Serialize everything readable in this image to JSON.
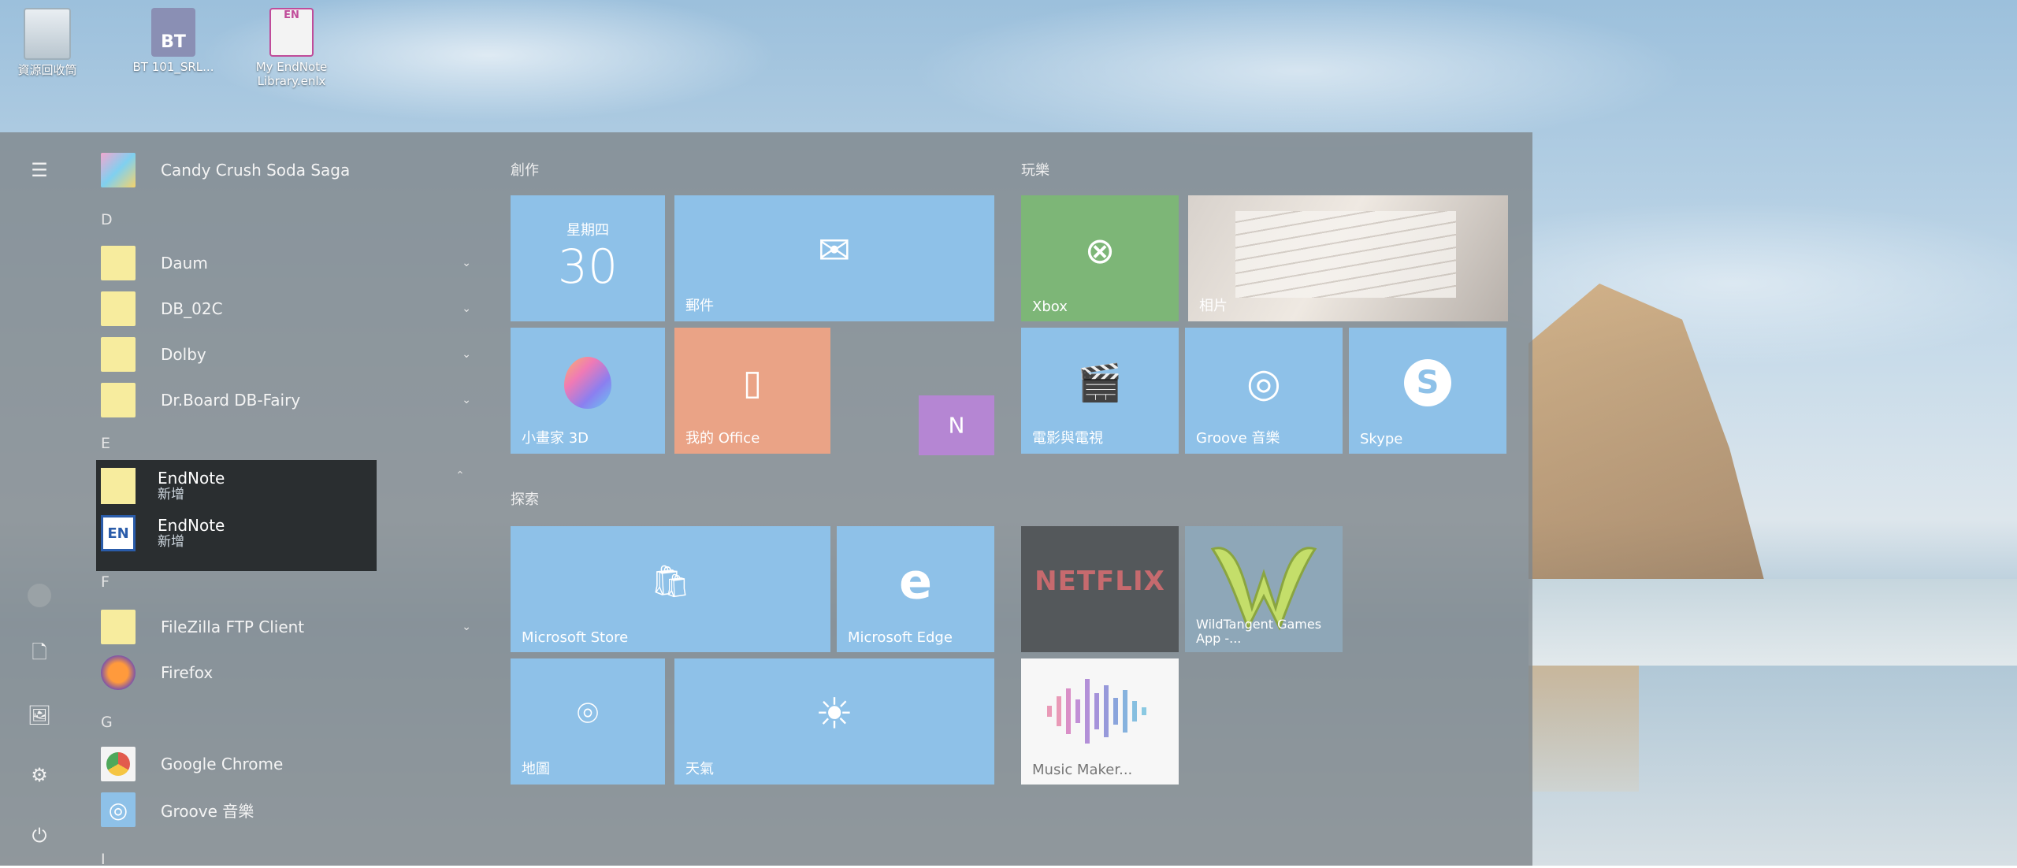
{
  "desktop": {
    "icons": [
      {
        "label": "資源回收筒",
        "icon": "recycle-bin-icon"
      },
      {
        "label": "BT 101_SRL...",
        "icon": "bt-app-icon",
        "badge": "BT"
      },
      {
        "label": "My EndNote Library.enlx",
        "icon": "endnote-library-file-icon",
        "badge": "EN"
      }
    ]
  },
  "rail": {
    "icons": [
      "hamburger-menu-icon",
      "user-avatar-icon",
      "documents-icon",
      "pictures-icon",
      "settings-gear-icon",
      "power-icon"
    ]
  },
  "app_list": {
    "candy": "Candy Crush Soda Saga",
    "letter_d": "D",
    "daum": "Daum",
    "db02c": "DB_02C",
    "dolby": "Dolby",
    "drboard": "Dr.Board DB-Fairy",
    "letter_e": "E",
    "endnote_folder": "EndNote",
    "endnote_folder_sub": "新增",
    "endnote_app": "EndNote",
    "endnote_app_sub": "新增",
    "letter_f": "F",
    "filezilla": "FileZilla FTP Client",
    "firefox": "Firefox",
    "letter_g": "G",
    "chrome": "Google Chrome",
    "groove": "Groove 音樂",
    "letter_i": "I"
  },
  "groups": {
    "create": "創作",
    "play": "玩樂",
    "explore": "探索"
  },
  "tiles": {
    "calendar_day": "星期四",
    "calendar_date": "30",
    "mail": "郵件",
    "paint3d": "小畫家 3D",
    "office": "我的 Office",
    "xbox": "Xbox",
    "photos": "相片",
    "movies": "電影與電視",
    "groove": "Groove 音樂",
    "skype": "Skype",
    "store": "Microsoft Store",
    "edge": "Microsoft Edge",
    "netflix": "NETFLIX",
    "wildtangent": "WildTangent Games App -...",
    "maps": "地圖",
    "weather": "天氣",
    "music_maker": "Music Maker..."
  },
  "colors": {
    "tile_blue": "#8ec1e8",
    "tile_green": "#7db677",
    "tile_orange": "#eaa386",
    "tile_purple": "#b586d3",
    "tile_dark": "#54585b"
  }
}
